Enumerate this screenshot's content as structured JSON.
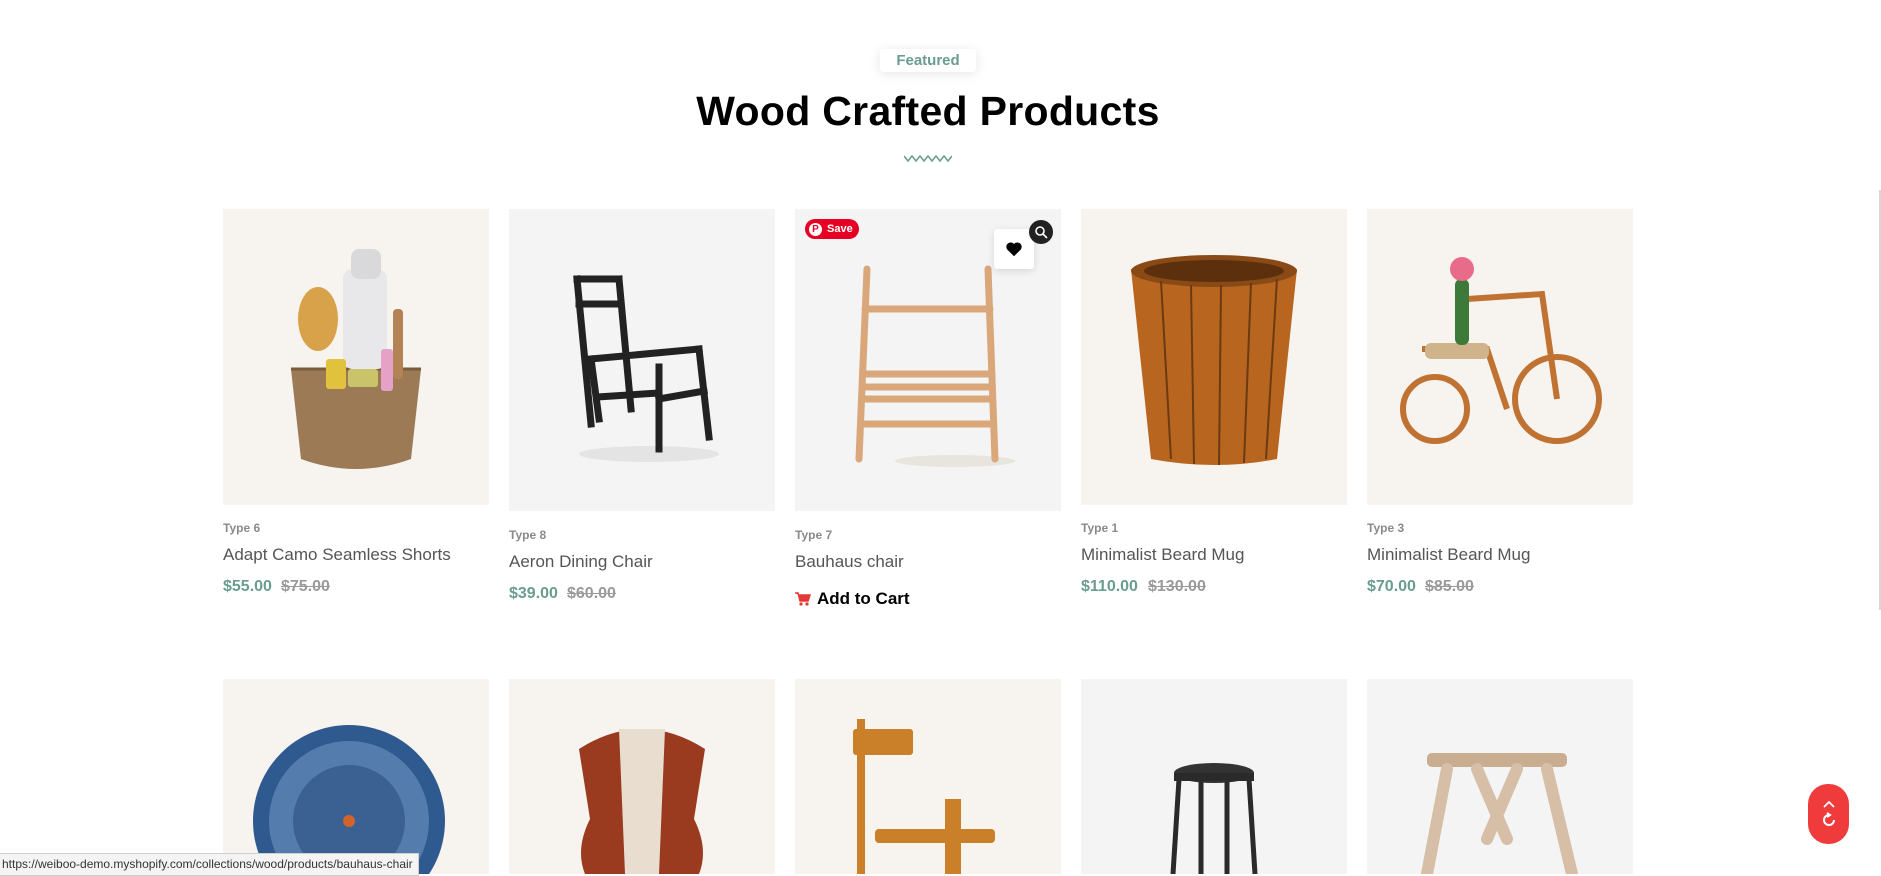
{
  "section": {
    "badge": "Featured",
    "title": "Wood Crafted Products",
    "accent_color": "#6a9d8f"
  },
  "products_row1": [
    {
      "type": "Type 6",
      "name": "Adapt Camo Seamless Shorts",
      "price": "$55.00",
      "old_price": "$75.00"
    },
    {
      "type": "Type 8",
      "name": "Aeron Dining Chair",
      "price": "$39.00",
      "old_price": "$60.00"
    },
    {
      "type": "Type 7",
      "name": "Bauhaus chair",
      "add_to_cart": "Add to Cart"
    },
    {
      "type": "Type 1",
      "name": "Minimalist Beard Mug",
      "price": "$110.00",
      "old_price": "$130.00"
    },
    {
      "type": "Type 3",
      "name": "Minimalist Beard Mug",
      "price": "$70.00",
      "old_price": "$85.00"
    }
  ],
  "pinterest": {
    "label": "Save",
    "color": "#e60023"
  },
  "status_bar": {
    "url": "https://weiboo-demo.myshopify.com/collections/wood/products/bauhaus-chair"
  },
  "icons": [
    "zigzag-divider-icon",
    "pinterest-icon",
    "heart-icon",
    "quick-view-icon",
    "cart-icon",
    "chevron-up-icon",
    "refresh-icon"
  ],
  "scroll_top_color": "#ef3b3b"
}
